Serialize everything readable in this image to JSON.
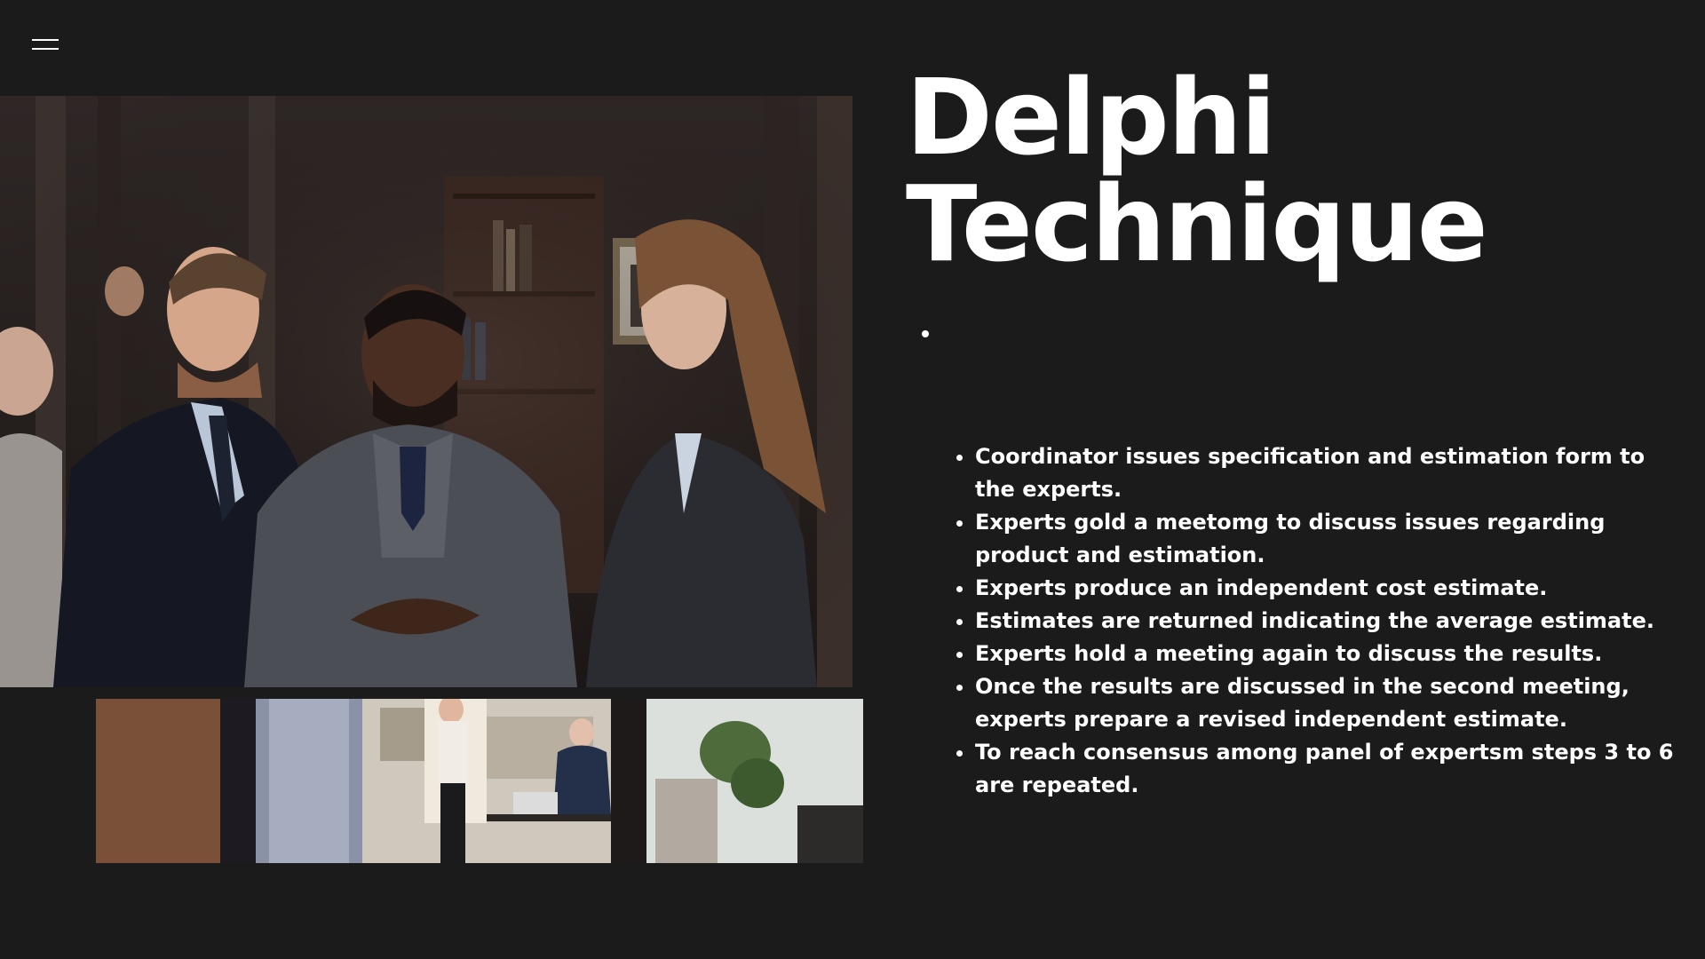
{
  "menu": {
    "icon": "hamburger-menu-icon"
  },
  "slide": {
    "title_line1": "Delphi",
    "title_line2": "Technique",
    "bullets": [
      "Coordinator issues specification and estimation form to the experts.",
      "Experts gold a meetomg to discuss issues regarding product and estimation.",
      "Experts produce an independent cost estimate.",
      "Estimates are returned indicating the average estimate.",
      "Experts hold a meeting again to discuss the results.",
      "Once the results are discussed in the second meeting, experts prepare a revised independent estimate.",
      "To reach consensus among panel of expertsm steps 3 to 6 are repeated."
    ]
  },
  "colors": {
    "background": "#1b1b1c",
    "text": "#ffffff"
  }
}
